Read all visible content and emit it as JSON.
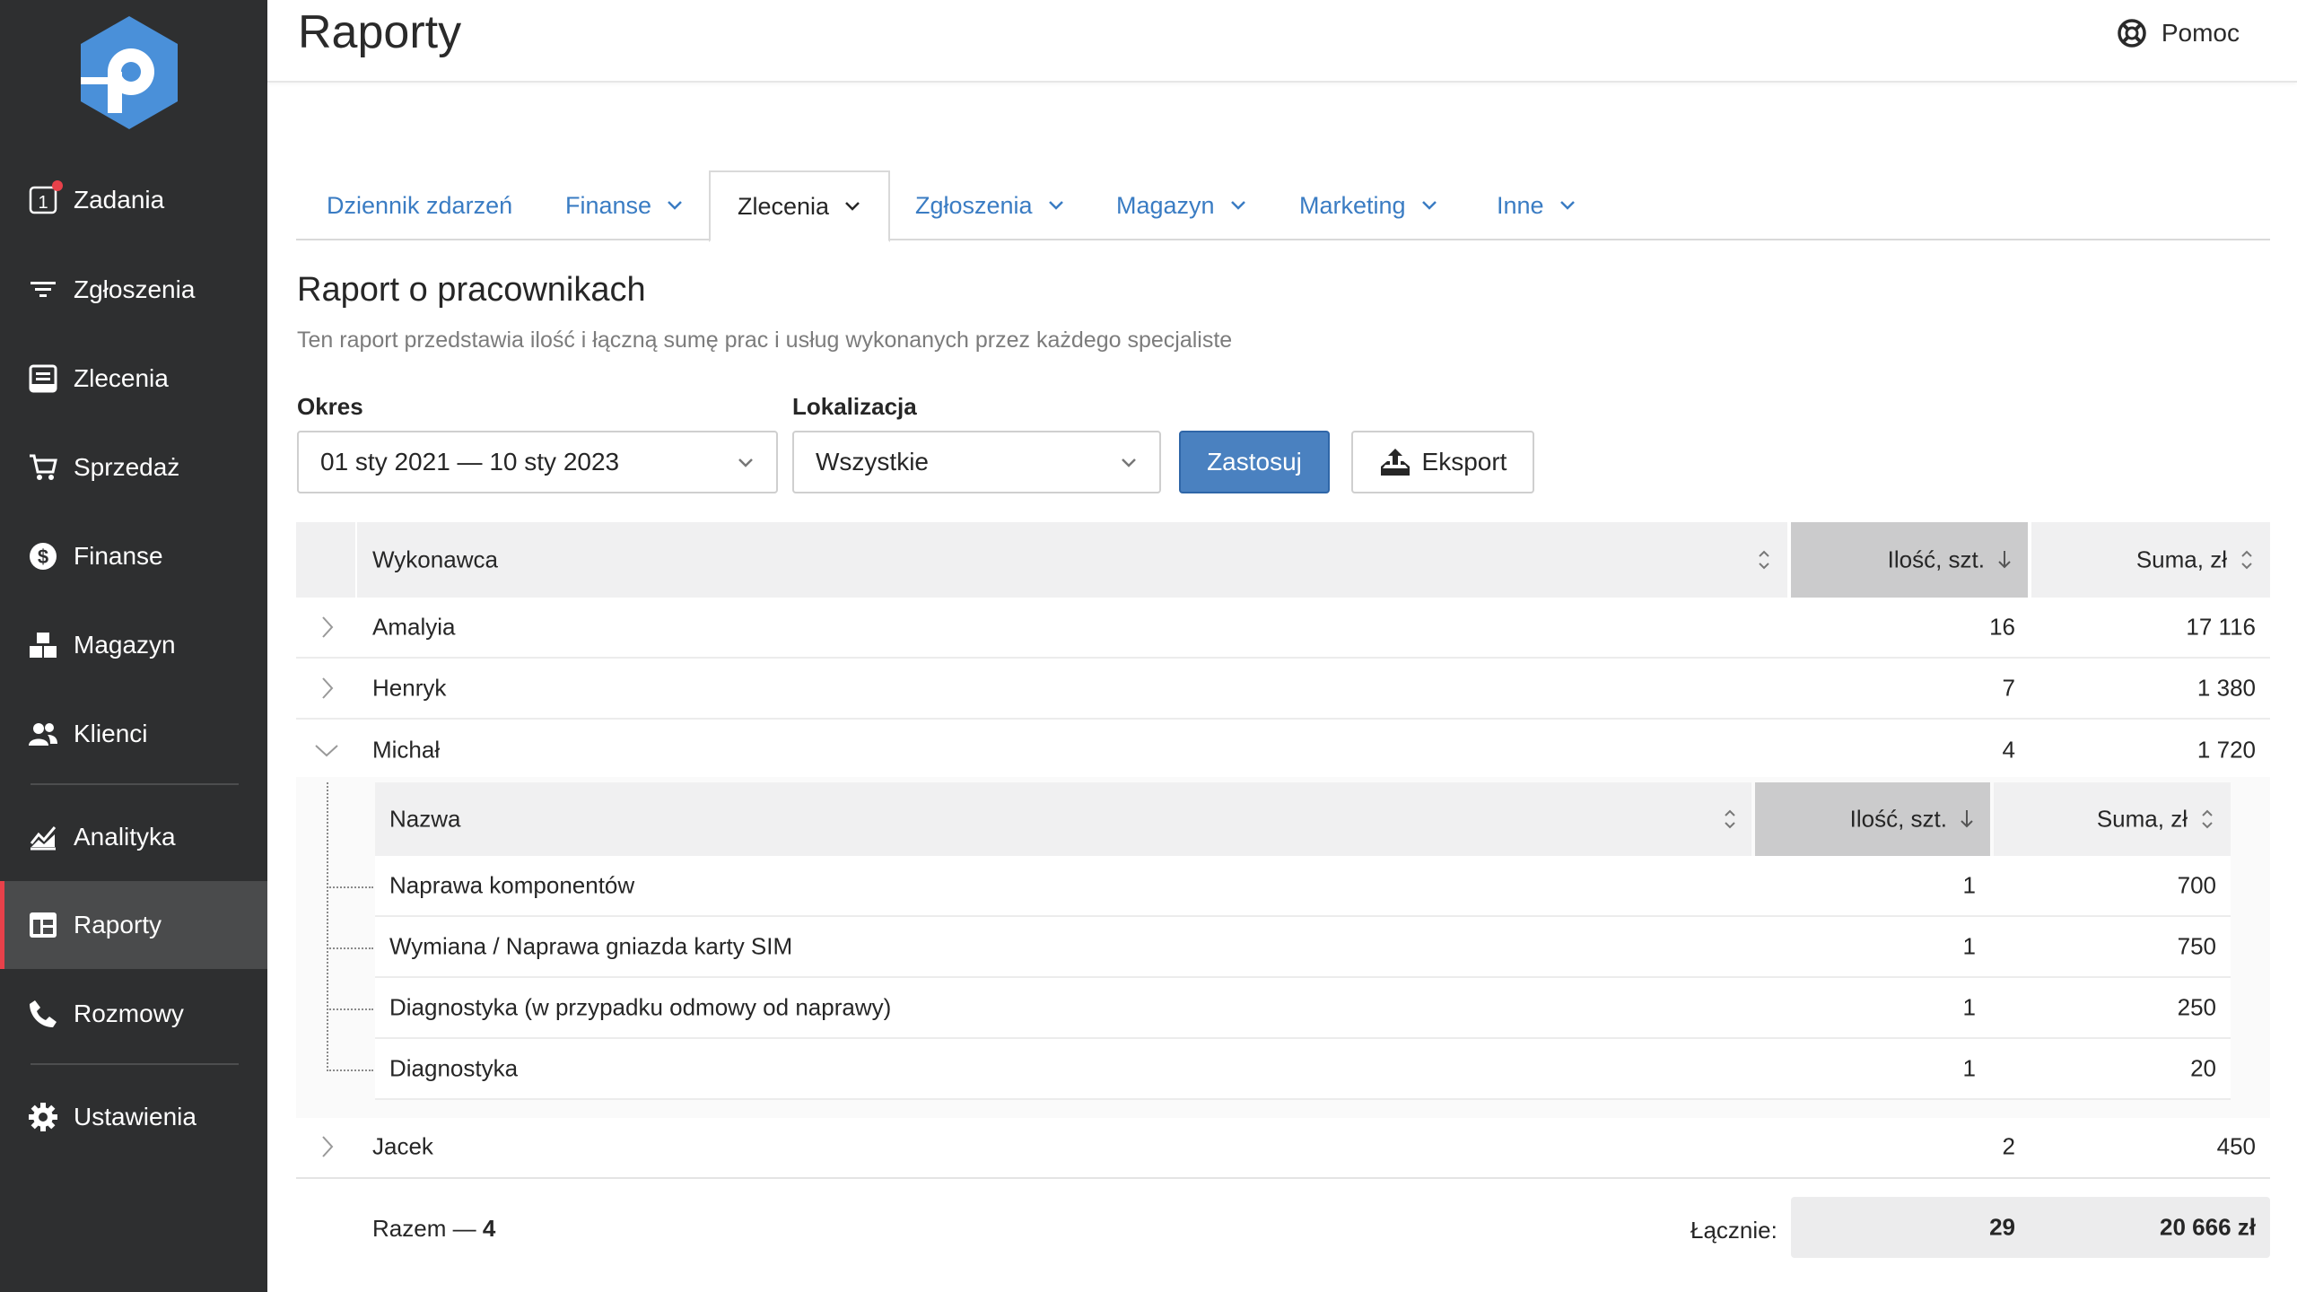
{
  "app": {
    "page_title": "Raporty",
    "help_label": "Pomoc"
  },
  "sidebar": {
    "items": [
      {
        "label": "Zadania",
        "icon": "tasks-icon"
      },
      {
        "label": "Zgłoszenia",
        "icon": "filter-icon"
      },
      {
        "label": "Zlecenia",
        "icon": "orders-icon"
      },
      {
        "label": "Sprzedaż",
        "icon": "cart-icon"
      },
      {
        "label": "Finanse",
        "icon": "dollar-icon"
      },
      {
        "label": "Magazyn",
        "icon": "warehouse-icon"
      },
      {
        "label": "Klienci",
        "icon": "clients-icon"
      },
      {
        "label": "Analityka",
        "icon": "analytics-icon"
      },
      {
        "label": "Raporty",
        "icon": "reports-icon"
      },
      {
        "label": "Rozmowy",
        "icon": "phone-icon"
      },
      {
        "label": "Ustawienia",
        "icon": "gear-icon"
      }
    ],
    "tasks_badge_number": "1",
    "active": "Raporty",
    "accent_color": "#e8414a"
  },
  "tabs": [
    {
      "label": "Dziennik zdarzeń",
      "has_dropdown": false
    },
    {
      "label": "Finanse",
      "has_dropdown": true
    },
    {
      "label": "Zlecenia",
      "has_dropdown": true,
      "active": true
    },
    {
      "label": "Zgłoszenia",
      "has_dropdown": true
    },
    {
      "label": "Magazyn",
      "has_dropdown": true
    },
    {
      "label": "Marketing",
      "has_dropdown": true
    },
    {
      "label": "Inne",
      "has_dropdown": true
    }
  ],
  "report": {
    "title": "Raport o pracownikach",
    "subtitle": "Ten raport przedstawia ilość i łączną sumę prac i usług wykonanych przez każdego specjaliste"
  },
  "filters": {
    "period_label": "Okres",
    "period_value": "01 sty 2021 — 10 sty 2023",
    "location_label": "Lokalizacja",
    "location_value": "Wszystkie",
    "apply_label": "Zastosuj",
    "export_label": "Eksport",
    "primary_color": "#4a81c0"
  },
  "table": {
    "columns": {
      "performer": "Wykonawca",
      "quantity": "Ilość, szt.",
      "sum": "Suma, zł"
    },
    "rows": [
      {
        "name": "Amalyia",
        "quantity": "16",
        "sum": "17 116",
        "expanded": false
      },
      {
        "name": "Henryk",
        "quantity": "7",
        "sum": "1 380",
        "expanded": false
      },
      {
        "name": "Michał",
        "quantity": "4",
        "sum": "1 720",
        "expanded": true
      },
      {
        "name": "Jacek",
        "quantity": "2",
        "sum": "450",
        "expanded": false
      }
    ],
    "nested": {
      "columns": {
        "name": "Nazwa",
        "quantity": "Ilość, szt.",
        "sum": "Suma, zł"
      },
      "rows": [
        {
          "name": "Naprawa komponentów",
          "quantity": "1",
          "sum": "700"
        },
        {
          "name": "Wymiana / Naprawa gniazda karty SIM",
          "quantity": "1",
          "sum": "750"
        },
        {
          "name": "Diagnostyka (w przypadku odmowy od naprawy)",
          "quantity": "1",
          "sum": "250"
        },
        {
          "name": "Diagnostyka",
          "quantity": "1",
          "sum": "20"
        }
      ]
    },
    "footer": {
      "count_label": "Razem — ",
      "count_value": "4",
      "total_label": "Łącznie:",
      "total_quantity": "29",
      "total_sum": "20 666 zł"
    }
  }
}
